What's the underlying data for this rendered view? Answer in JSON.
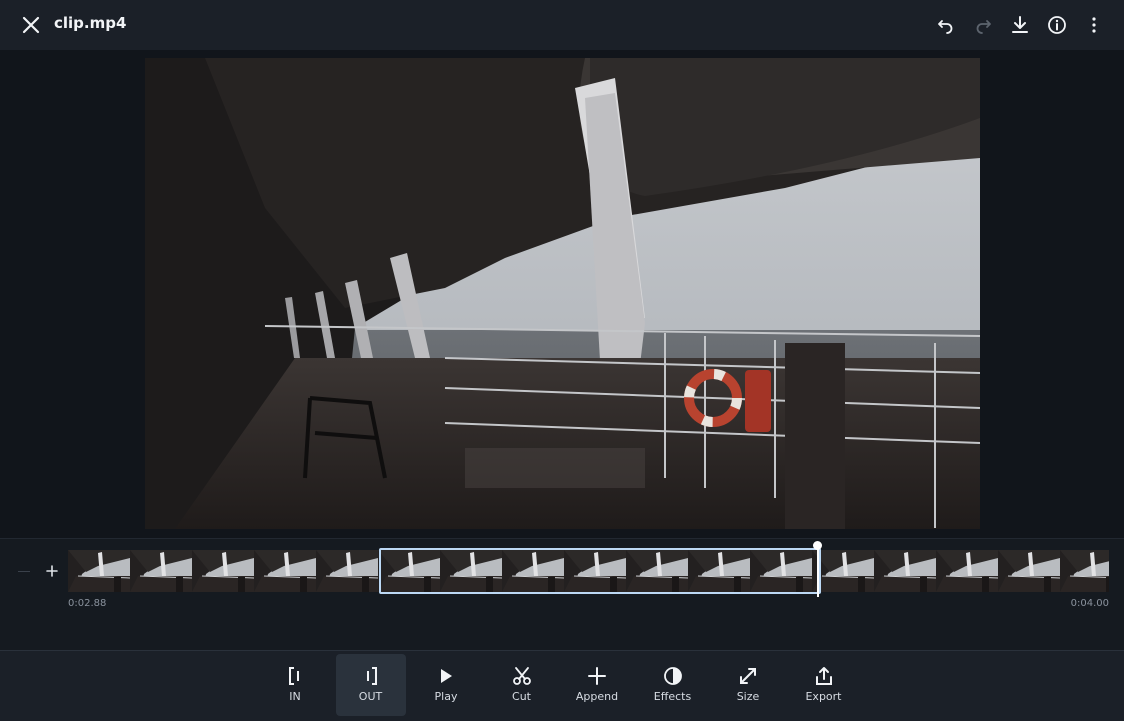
{
  "header": {
    "title": "clip.mp4",
    "close_icon": "close-icon",
    "actions": [
      "undo-icon",
      "redo-icon",
      "download-icon",
      "info-icon",
      "more-vert-icon"
    ]
  },
  "timeline": {
    "start_time": "0:02.88",
    "end_time": "0:04.00",
    "add_icon": "plus-icon",
    "frame_count": 17
  },
  "toolbar": {
    "tools": [
      {
        "label": "IN",
        "icon": "in-point-icon",
        "active": false
      },
      {
        "label": "OUT",
        "icon": "out-point-icon",
        "active": true
      },
      {
        "label": "Play",
        "icon": "play-icon",
        "active": false
      },
      {
        "label": "Cut",
        "icon": "scissors-icon",
        "active": false
      },
      {
        "label": "Append",
        "icon": "plus-icon",
        "active": false
      },
      {
        "label": "Effects",
        "icon": "contrast-icon",
        "active": false
      },
      {
        "label": "Size",
        "icon": "resize-icon",
        "active": false
      },
      {
        "label": "Export",
        "icon": "share-icon",
        "active": false
      }
    ]
  },
  "colors": {
    "background": "#11151b",
    "bar": "#1b2028",
    "selection": "#bcd8f4",
    "active_tool": "#2a323c"
  }
}
